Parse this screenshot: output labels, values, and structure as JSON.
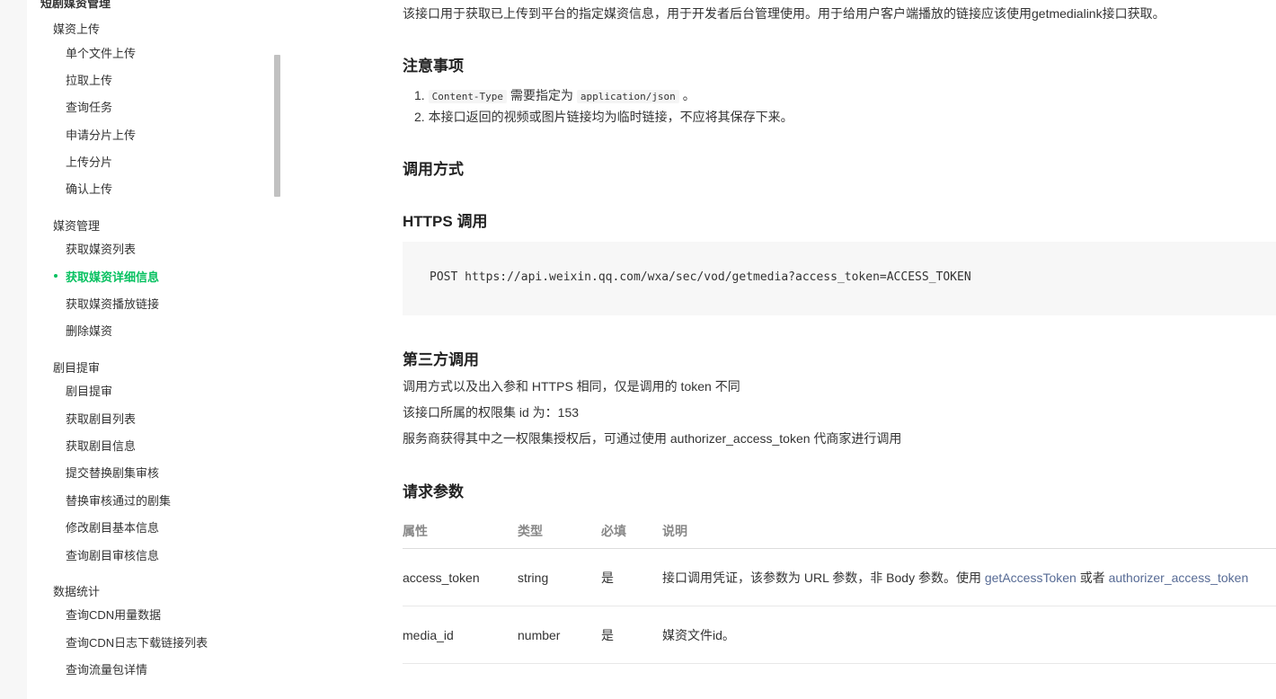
{
  "sidebar": {
    "section_title": "短剧媒资管理",
    "groups": [
      {
        "label": "媒资上传",
        "items": [
          "单个文件上传",
          "拉取上传",
          "查询任务",
          "申请分片上传",
          "上传分片",
          "确认上传"
        ]
      },
      {
        "label": "媒资管理",
        "items": [
          "获取媒资列表",
          "获取媒资详细信息",
          "获取媒资播放链接",
          "删除媒资"
        ]
      },
      {
        "label": "剧目提审",
        "items": [
          "剧目提审",
          "获取剧目列表",
          "获取剧目信息",
          "提交替换剧集审核",
          "替换审核通过的剧集",
          "修改剧目基本信息",
          "查询剧目审核信息"
        ]
      },
      {
        "label": "数据统计",
        "items": [
          "查询CDN用量数据",
          "查询CDN日志下载链接列表",
          "查询流量包详情"
        ]
      }
    ],
    "active_item": "获取媒资详细信息"
  },
  "content": {
    "intro": "该接口用于获取已上传到平台的指定媒资信息，用于开发者后台管理使用。用于给用户客户端播放的链接应该使用getmedialink接口获取。",
    "notes_title": "注意事项",
    "note1_num": "1.",
    "note1_code1": "Content-Type",
    "note1_text": "需要指定为",
    "note1_code2": "application/json",
    "note1_end": "。",
    "note2_num": "2.",
    "note2": "本接口返回的视频或图片链接均为临时链接，不应将其保存下来。",
    "call_title": "调用方式",
    "https_title": "HTTPS 调用",
    "https_code": "POST https://api.weixin.qq.com/wxa/sec/vod/getmedia?access_token=ACCESS_TOKEN",
    "third_title": "第三方调用",
    "third_line1": "调用方式以及出入参和 HTTPS 相同，仅是调用的 token 不同",
    "third_line2": "该接口所属的权限集 id 为：153",
    "third_line3": "服务商获得其中之一权限集授权后，可通过使用 authorizer_access_token 代商家进行调用",
    "params_title": "请求参数",
    "table": {
      "headers": [
        "属性",
        "类型",
        "必填",
        "说明"
      ],
      "rows": [
        {
          "name": "access_token",
          "type": "string",
          "required": "是",
          "desc": "接口调用凭证，该参数为 URL 参数，非 Body 参数。使用",
          "link1": "getAccessToken",
          "mid": "或者",
          "link2": "authorizer_access_token"
        },
        {
          "name": "media_id",
          "type": "number",
          "required": "是",
          "desc": "媒资文件id。"
        }
      ]
    }
  }
}
